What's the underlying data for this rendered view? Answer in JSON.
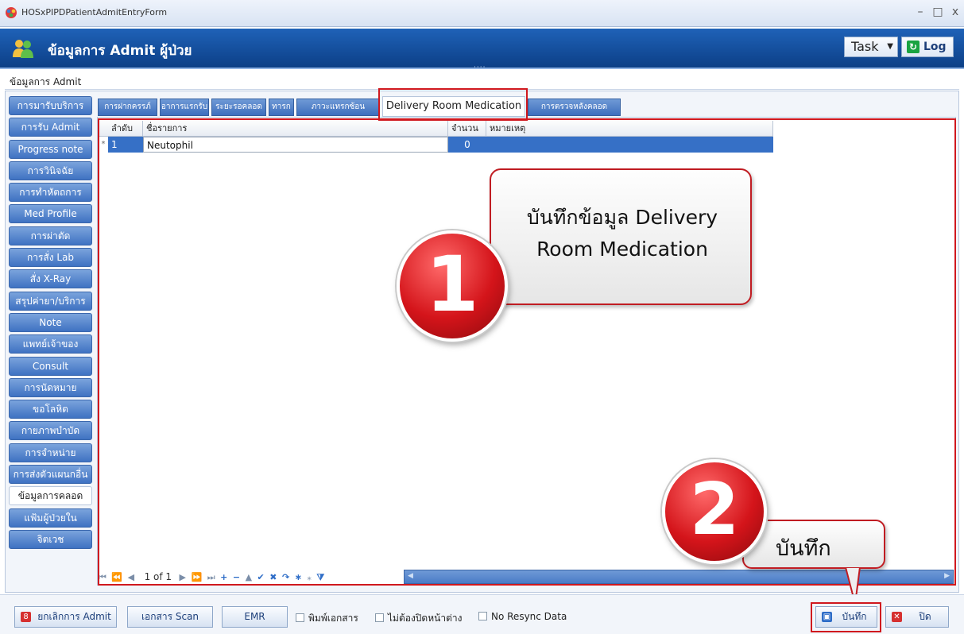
{
  "window": {
    "title": "HOSxPIPDPatientAdmitEntryForm",
    "minimize": "–",
    "maximize": "□",
    "close": "x"
  },
  "header": {
    "title": "ข้อมูลการ Admit ผู้ป่วย",
    "task_label": "Task",
    "task_caret": "▼",
    "log_label": "Log",
    "dots": "····"
  },
  "group_label": "ข้อมูลการ Admit",
  "sidebar": {
    "items": [
      {
        "label": "การมารับบริการ"
      },
      {
        "label": "การรับ Admit"
      },
      {
        "label": "Progress note"
      },
      {
        "label": "การวินิจฉัย"
      },
      {
        "label": "การทำหัตถการ"
      },
      {
        "label": "Med Profile"
      },
      {
        "label": "การผ่าตัด"
      },
      {
        "label": "การสั่ง Lab"
      },
      {
        "label": "สั่ง X-Ray"
      },
      {
        "label": "สรุปค่ายา/บริการ"
      },
      {
        "label": "Note"
      },
      {
        "label": "แพทย์เจ้าของ"
      },
      {
        "label": "Consult"
      },
      {
        "label": "การนัดหมาย"
      },
      {
        "label": "ขอโลหิต"
      },
      {
        "label": "กายภาพบำบัด"
      },
      {
        "label": "การจำหน่าย"
      },
      {
        "label": "การส่งตัวแผนกอื่น"
      },
      {
        "label": "ข้อมูลการคลอด",
        "active": true
      },
      {
        "label": "แฟ้มผู้ป่วยใน"
      },
      {
        "label": "จิตเวช"
      }
    ]
  },
  "tabs": [
    {
      "label": "การฝากครรภ์"
    },
    {
      "label": "อาการแรกรับ"
    },
    {
      "label": "ระยะรอคลอด"
    },
    {
      "label": "ทารก"
    },
    {
      "label": "ภาวะแทรกซ้อน"
    },
    {
      "label": "Delivery Room Medication",
      "active": true
    },
    {
      "label": "การตรวจหลังคลอด"
    }
  ],
  "grid": {
    "columns": [
      "ลำดับ",
      "ชื่อรายการ",
      "จำนวน",
      "หมายเหตุ"
    ],
    "rows": [
      {
        "indicator": "*",
        "no": "1",
        "name": "Neutophil",
        "qty": "0",
        "note": ""
      }
    ]
  },
  "navigator": {
    "page_text": "1 of 1"
  },
  "callouts": {
    "step1_number": "1",
    "step1_line1": "บันทึกข้อมูล Delivery",
    "step1_line2": "Room Medication",
    "step2_number": "2",
    "step2_text": "บันทึก"
  },
  "bottom": {
    "cancel_admit": "ยกเลิกการ Admit",
    "scan_docs": "เอกสาร Scan",
    "emr": "EMR",
    "print_docs": "พิมพ์เอกสาร",
    "no_close_window": "ไม่ต้องปิดหน้าต่าง",
    "no_resync": "No Resync Data",
    "save": "บันทึก",
    "close": "ปิด"
  },
  "colors": {
    "header_blue": "#1f62b8",
    "selected_row": "#3670c6",
    "highlight_red": "#d0181e"
  }
}
